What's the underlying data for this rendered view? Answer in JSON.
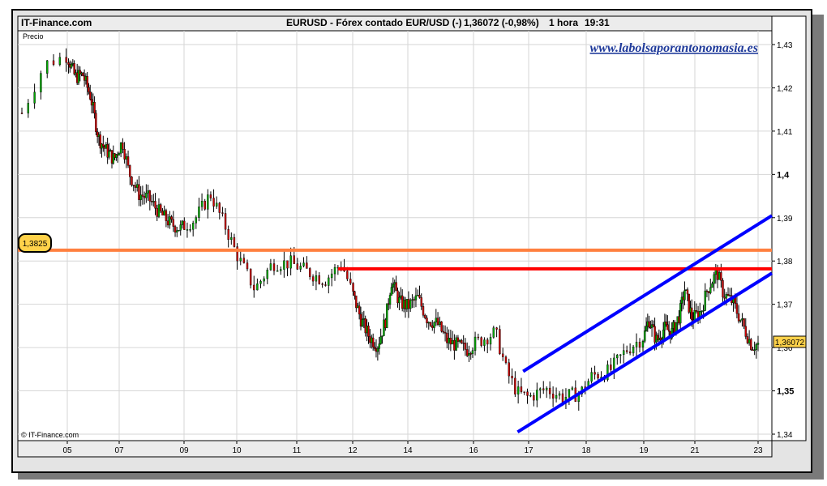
{
  "header": {
    "source": "IT-Finance.com",
    "instrument": "EURUSD - Fórex contado EUR/USD (-)",
    "quote": "1,36072 (-0,98%)",
    "interval": "1 hora",
    "time": "19:31"
  },
  "watermark": "www.labolsaporantonomasia.es",
  "copyright": "© IT-Finance.com",
  "colors": {
    "candle_up": "#00aa00",
    "candle_down": "#cc0000",
    "support_line": "#ff8040",
    "resistance_line": "#ff0000",
    "channel": "#0000ff",
    "price_tag": "#ffd24a"
  },
  "chart_data": {
    "type": "candlestick",
    "ylabel": "Precio",
    "ylim": [
      1.34,
      1.43
    ],
    "y_ticks": [
      "1,43",
      "1,42",
      "1,41",
      "1,4",
      "1,39",
      "1,38",
      "1,37",
      "1,36",
      "1,35",
      "1,34"
    ],
    "x_ticks": [
      "05",
      "07",
      "09",
      "10",
      "11",
      "12",
      "14",
      "16",
      "17",
      "18",
      "19",
      "21",
      "23"
    ],
    "last_price": "1,36072",
    "last_price_value": 1.36072,
    "horizontal_level_label": "1,3825",
    "horizontal_level_value": 1.3825,
    "resistance_level": 1.3782,
    "channel": {
      "upper": {
        "from": {
          "x": "16.9",
          "y": 1.3545
        },
        "to": {
          "x": "23",
          "y": 1.3885
        }
      },
      "lower": {
        "from": {
          "x": "16.8",
          "y": 1.3405
        },
        "to": {
          "x": "23",
          "y": 1.3752
        }
      }
    },
    "price_path": [
      [
        "04.6",
        1.4142
      ],
      [
        "04.8",
        1.4255
      ],
      [
        "05.0",
        1.4275
      ],
      [
        "05.3",
        1.4225
      ],
      [
        "05.6",
        1.423
      ],
      [
        "05.9",
        1.418
      ],
      [
        "06.2",
        1.4085
      ],
      [
        "06.5",
        1.4055
      ],
      [
        "06.8",
        1.4035
      ],
      [
        "07.1",
        1.4075
      ],
      [
        "07.3",
        1.4005
      ],
      [
        "07.6",
        1.3955
      ],
      [
        "07.9",
        1.3945
      ],
      [
        "08.2",
        1.3915
      ],
      [
        "08.6",
        1.3885
      ],
      [
        "08.9",
        1.3875
      ],
      [
        "09.2",
        1.3895
      ],
      [
        "09.5",
        1.3955
      ],
      [
        "09.8",
        1.3875
      ],
      [
        "10.0",
        1.3815
      ],
      [
        "10.3",
        1.3735
      ],
      [
        "10.6",
        1.3795
      ],
      [
        "10.9",
        1.3795
      ],
      [
        "11.2",
        1.3775
      ],
      [
        "11.5",
        1.3755
      ],
      [
        "11.8",
        1.3795
      ],
      [
        "12.0",
        1.3725
      ],
      [
        "12.3",
        1.3665
      ],
      [
        "12.6",
        1.3625
      ],
      [
        "12.9",
        1.3605
      ],
      [
        "13.2",
        1.3665
      ],
      [
        "13.4",
        1.3755
      ],
      [
        "13.7",
        1.3705
      ],
      [
        "14.0",
        1.3695
      ],
      [
        "14.3",
        1.3715
      ],
      [
        "14.6",
        1.3665
      ],
      [
        "14.9",
        1.3655
      ],
      [
        "15.2",
        1.3615
      ],
      [
        "15.5",
        1.3605
      ],
      [
        "15.8",
        1.3595
      ],
      [
        "16.1",
        1.3615
      ],
      [
        "16.4",
        1.3635
      ],
      [
        "16.6",
        1.3545
      ],
      [
        "16.8",
        1.3495
      ],
      [
        "17.0",
        1.3485
      ],
      [
        "17.3",
        1.3505
      ],
      [
        "17.6",
        1.3485
      ],
      [
        "17.9",
        1.3495
      ],
      [
        "18.1",
        1.3535
      ],
      [
        "18.4",
        1.3545
      ],
      [
        "18.7",
        1.3595
      ],
      [
        "19.0",
        1.3625
      ],
      [
        "19.2",
        1.3665
      ],
      [
        "19.5",
        1.3615
      ],
      [
        "19.8",
        1.3645
      ],
      [
        "20.1",
        1.3635
      ],
      [
        "20.4",
        1.3675
      ],
      [
        "20.6",
        1.3735
      ],
      [
        "20.9",
        1.3665
      ],
      [
        "21.2",
        1.3685
      ],
      [
        "21.4",
        1.3735
      ],
      [
        "21.7",
        1.3775
      ],
      [
        "21.9",
        1.3725
      ],
      [
        "22.2",
        1.3705
      ],
      [
        "22.5",
        1.3655
      ],
      [
        "22.8",
        1.3605
      ],
      [
        "23.0",
        1.36072
      ]
    ]
  }
}
